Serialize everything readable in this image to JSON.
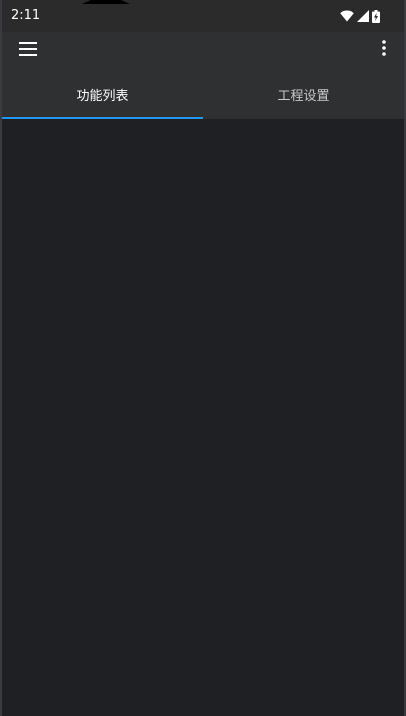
{
  "status_bar": {
    "time": "2:11",
    "icons": [
      "wifi-icon",
      "signal-icon",
      "battery-charging-icon"
    ]
  },
  "app_bar": {
    "menu_icon": "hamburger-menu-icon",
    "overflow_icon": "more-vert-icon"
  },
  "tabs": [
    {
      "label": "功能列表",
      "active": true
    },
    {
      "label": "工程设置",
      "active": false
    }
  ],
  "colors": {
    "accent": "#2196f3",
    "app_bar": "#2f3032",
    "status_bar": "#2b2b2c",
    "background": "#1f2023"
  }
}
